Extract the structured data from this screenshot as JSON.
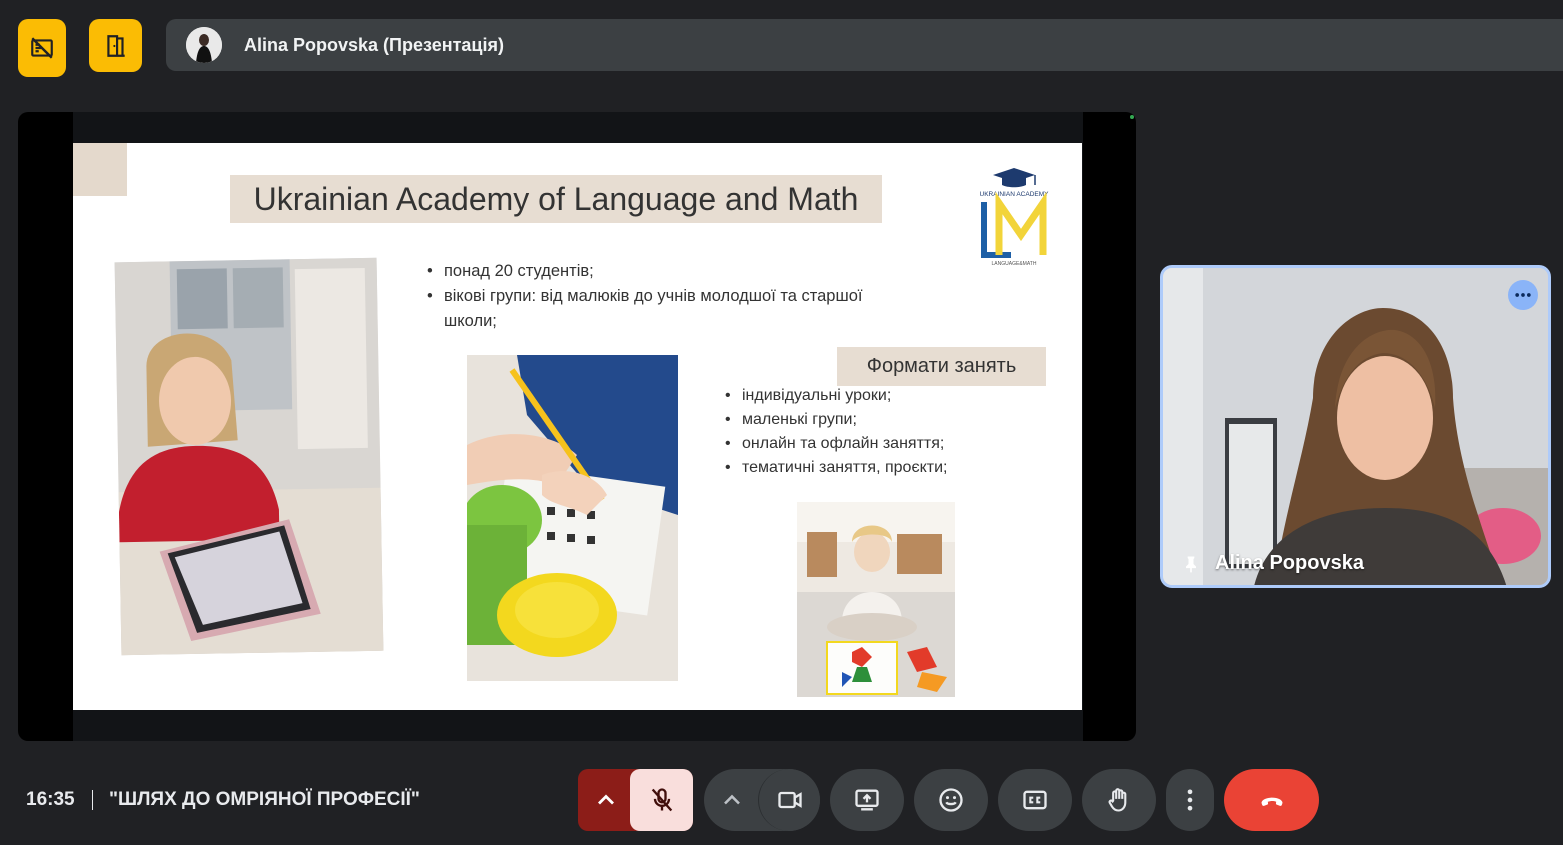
{
  "top_buttons": [
    {
      "icon": "no-sign-language-icon"
    },
    {
      "icon": "door-icon"
    }
  ],
  "presenter": {
    "label": "Alina Popovska (Презентація)"
  },
  "slide": {
    "title": "Ukrainian Academy of Language and Math",
    "logo": {
      "top_text": "UKRAINIAN ACADEMY",
      "letters": "LM",
      "bottom_text": "LANGUAGE&MATH"
    },
    "bullets": [
      "понад 20 студентів;",
      "вікові групи: від малюків до учнів молодшої та старшої школи;"
    ],
    "formats_title": "Формати занять",
    "formats": [
      "індивідуальні уроки;",
      "маленькі групи;",
      "онлайн та офлайн заняття;",
      "тематичні заняття, проєкти;"
    ]
  },
  "self_tile": {
    "name": "Alina Popovska",
    "more_icon": "more-horizontal-icon",
    "pin_icon": "pin-icon"
  },
  "bottom_bar": {
    "time": "16:35",
    "meeting_name": "\"ШЛЯХ ДО ОМРІЯНОЇ ПРОФЕСІЇ\""
  },
  "controls": [
    {
      "name": "mic-options",
      "icon": "chevron-up-icon"
    },
    {
      "name": "mic-toggle",
      "icon": "mic-off-icon",
      "state": "muted"
    },
    {
      "name": "camera-options",
      "icon": "chevron-up-icon"
    },
    {
      "name": "camera-toggle",
      "icon": "video-camera-icon"
    },
    {
      "name": "present",
      "icon": "present-screen-icon"
    },
    {
      "name": "reactions",
      "icon": "emoji-icon"
    },
    {
      "name": "captions",
      "icon": "closed-captions-icon"
    },
    {
      "name": "raise-hand",
      "icon": "hand-icon"
    },
    {
      "name": "more-options",
      "icon": "more-vertical-icon"
    },
    {
      "name": "leave-call",
      "icon": "phone-hangup-icon"
    }
  ],
  "colors": {
    "background": "#202124",
    "accent_yellow": "#fbbc04",
    "control_dark": "#3c4043",
    "mic_muted_bg": "#f9dedc",
    "mic_group_bg": "#8c1d18",
    "end_call": "#ea4335",
    "tile_border": "#aecbfa",
    "slide_beige": "#e7ddd2"
  }
}
